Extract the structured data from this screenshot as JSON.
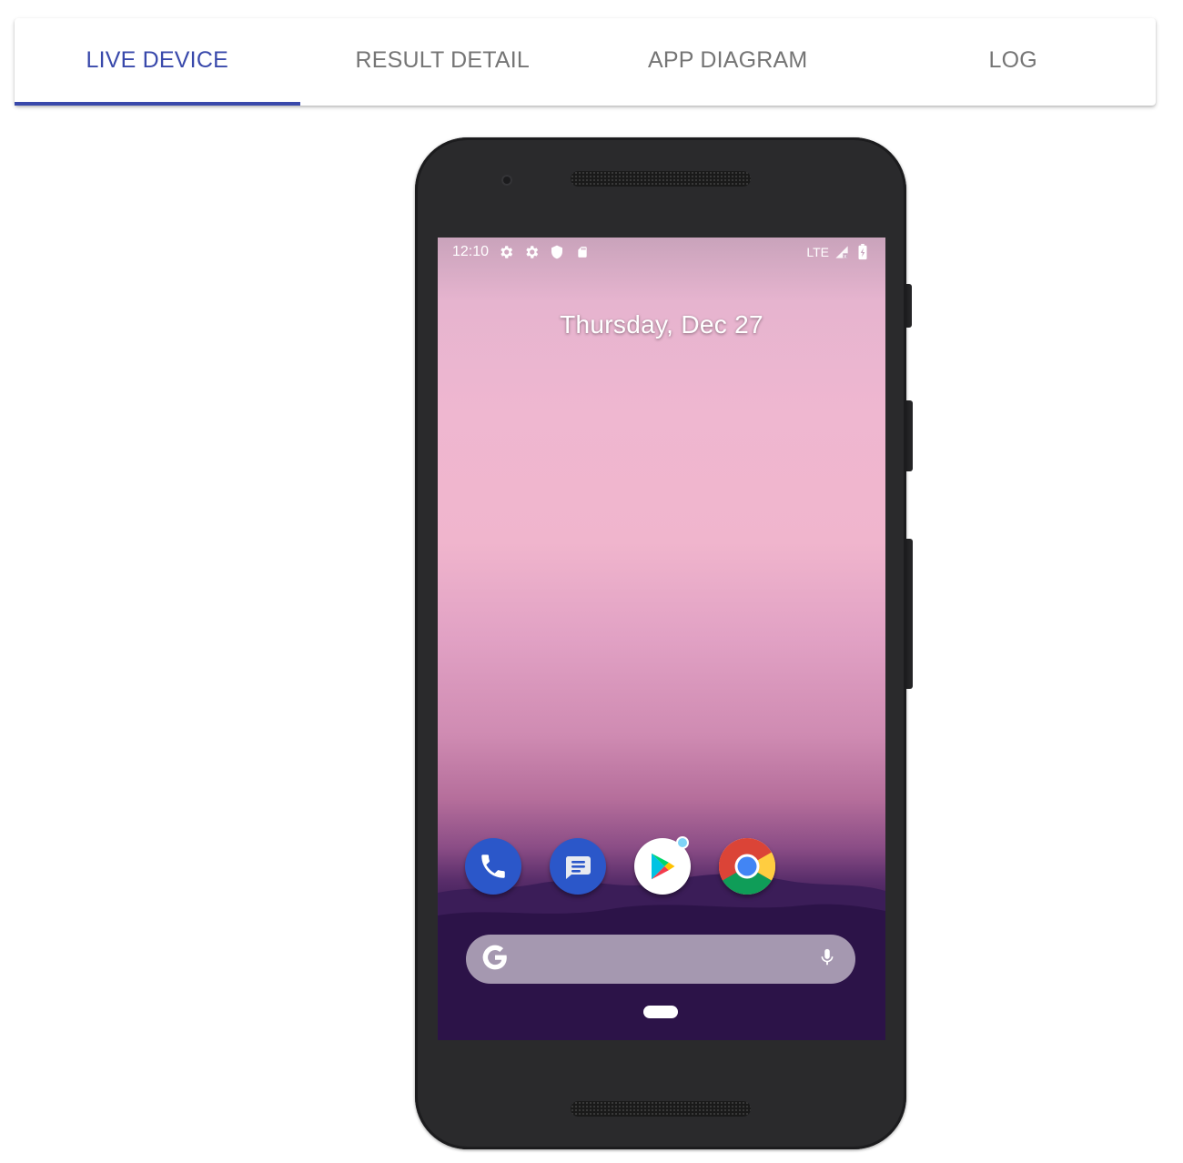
{
  "tabs": [
    {
      "label": "LIVE DEVICE",
      "active": true
    },
    {
      "label": "RESULT DETAIL",
      "active": false
    },
    {
      "label": "APP DIAGRAM",
      "active": false
    },
    {
      "label": "LOG",
      "active": false
    }
  ],
  "colors": {
    "accent": "#3949ab",
    "inactive_tab": "#757575"
  },
  "device": {
    "status_bar": {
      "time": "12:10",
      "left_icons": [
        "settings-icon",
        "settings-icon",
        "shield-icon",
        "sd-card-icon"
      ],
      "network": "LTE",
      "right_icons": [
        "signal-icon",
        "battery-charging-icon"
      ]
    },
    "date": "Thursday, Dec 27",
    "dock_apps": [
      "phone-app-icon",
      "messages-app-icon",
      "play-store-app-icon",
      "chrome-app-icon"
    ],
    "search_bar": {
      "icons": [
        "google-g-icon",
        "microphone-icon"
      ]
    }
  }
}
